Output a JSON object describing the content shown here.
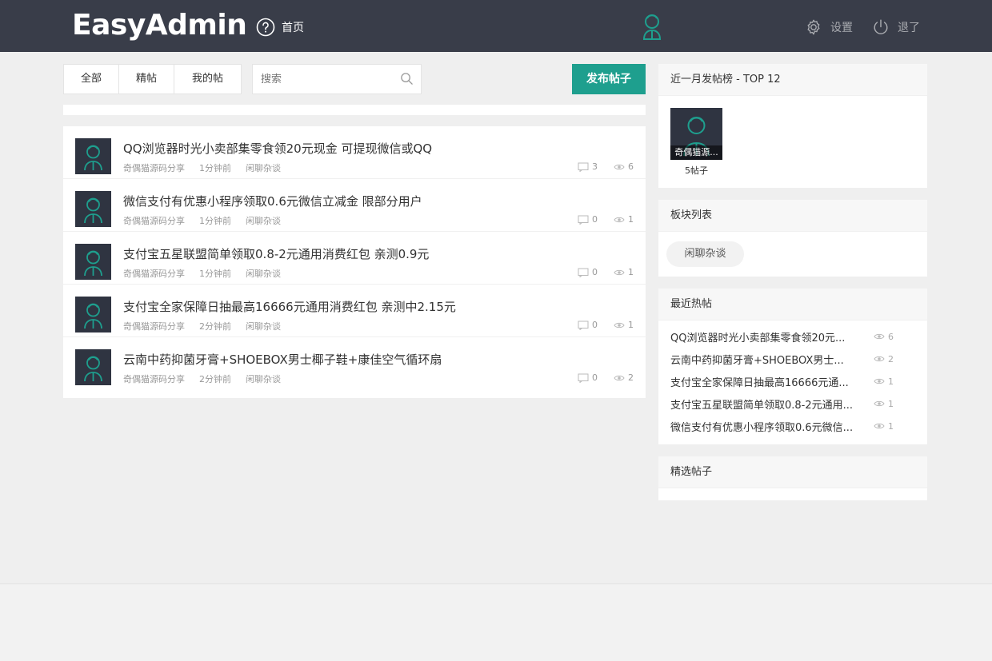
{
  "header": {
    "logo": "EasyAdmin",
    "home_label": "首页",
    "settings_label": "设置",
    "logout_label": "退了"
  },
  "toolbar": {
    "filters": [
      "全部",
      "精帖",
      "我的帖"
    ],
    "search_placeholder": "搜索",
    "publish_label": "发布帖子"
  },
  "posts": [
    {
      "title": "QQ浏览器时光小卖部集零食领20元现金 可提现微信或QQ",
      "author": "奇偶猫源码分享",
      "time": "1分钟前",
      "board": "闲聊杂谈",
      "comments": "3",
      "views": "6"
    },
    {
      "title": "微信支付有优惠小程序领取0.6元微信立减金 限部分用户",
      "author": "奇偶猫源码分享",
      "time": "1分钟前",
      "board": "闲聊杂谈",
      "comments": "0",
      "views": "1"
    },
    {
      "title": "支付宝五星联盟简单领取0.8-2元通用消费红包 亲测0.9元",
      "author": "奇偶猫源码分享",
      "time": "1分钟前",
      "board": "闲聊杂谈",
      "comments": "0",
      "views": "1"
    },
    {
      "title": "支付宝全家保障日抽最高16666元通用消费红包 亲测中2.15元",
      "author": "奇偶猫源码分享",
      "time": "2分钟前",
      "board": "闲聊杂谈",
      "comments": "0",
      "views": "1"
    },
    {
      "title": "云南中药抑菌牙膏+SHOEBOX男士椰子鞋+康佳空气循环扇",
      "author": "奇偶猫源码分享",
      "time": "2分钟前",
      "board": "闲聊杂谈",
      "comments": "0",
      "views": "2"
    }
  ],
  "sidebar": {
    "top_title": "近一月发帖榜 - TOP 12",
    "top_user": {
      "name": "奇偶猫源...",
      "count": "5帖子"
    },
    "boards_title": "板块列表",
    "boards": [
      "闲聊杂谈"
    ],
    "hot_title": "最近热帖",
    "hot_posts": [
      {
        "title": "QQ浏览器时光小卖部集零食领20元...",
        "views": "6"
      },
      {
        "title": "云南中药抑菌牙膏+SHOEBOX男士...",
        "views": "2"
      },
      {
        "title": "支付宝全家保障日抽最高16666元通...",
        "views": "1"
      },
      {
        "title": "支付宝五星联盟简单领取0.8-2元通用...",
        "views": "1"
      },
      {
        "title": "微信支付有优惠小程序领取0.6元微信...",
        "views": "1"
      }
    ],
    "featured_title": "精选帖子"
  },
  "colors": {
    "header_bg": "#393d49",
    "accent": "#1e9f8e",
    "avatar_bg": "#2f3441"
  },
  "icons": [
    "help-circle-icon",
    "avatar-icon",
    "gear-icon",
    "power-icon",
    "search-icon",
    "comment-icon",
    "eye-icon"
  ]
}
